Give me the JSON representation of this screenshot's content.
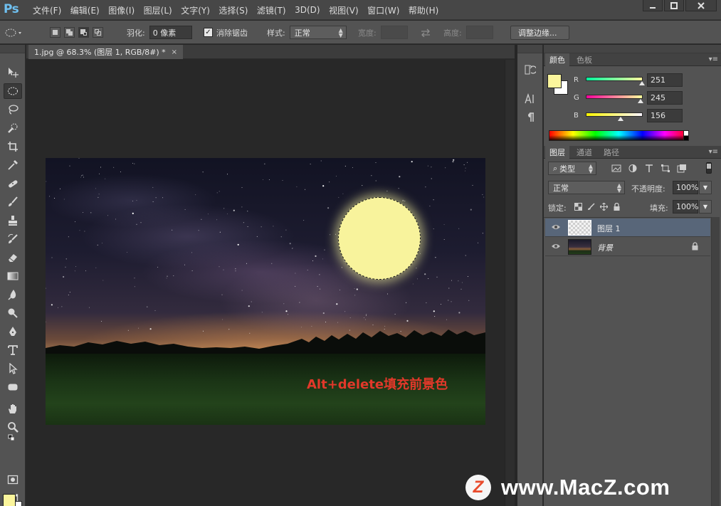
{
  "app": {
    "logo": "Ps"
  },
  "menu": [
    "文件(F)",
    "编辑(E)",
    "图像(I)",
    "图层(L)",
    "文字(Y)",
    "选择(S)",
    "滤镜(T)",
    "3D(D)",
    "视图(V)",
    "窗口(W)",
    "帮助(H)"
  ],
  "options": {
    "feather_label": "羽化:",
    "feather_value": "0 像素",
    "antialias_label": "消除锯齿",
    "antialias_checked": true,
    "style_label": "样式:",
    "style_value": "正常",
    "width_label": "宽度:",
    "height_label": "高度:",
    "refine_edge": "调整边缘..."
  },
  "document": {
    "tab_title": "1.jpg @ 68.3% (图层 1, RGB/8#) *",
    "close": "×",
    "annotation": "Alt+delete填充前景色"
  },
  "color_panel": {
    "tabs": [
      "颜色",
      "色板"
    ],
    "foreground": "#fbf59c",
    "background": "#ffffff",
    "channels": [
      {
        "label": "R",
        "value": "251"
      },
      {
        "label": "G",
        "value": "245"
      },
      {
        "label": "B",
        "value": "156"
      }
    ]
  },
  "layers_panel": {
    "tabs": [
      "图层",
      "通道",
      "路径"
    ],
    "filter_kind": "类型",
    "blend_mode": "正常",
    "opacity_label": "不透明度:",
    "opacity_value": "100%",
    "lock_label": "锁定:",
    "fill_label": "填充:",
    "fill_value": "100%",
    "layers": [
      {
        "name": "图层 1",
        "selected": true,
        "visible": true,
        "locked": false
      },
      {
        "name": "背景",
        "selected": false,
        "visible": true,
        "locked": true
      }
    ]
  },
  "watermark": {
    "logo_letter": "Z",
    "text": "www.MacZ.com"
  },
  "colors": {
    "accent": "#fbf59c",
    "annotation": "#e2382a",
    "selected_layer": "#586679"
  }
}
